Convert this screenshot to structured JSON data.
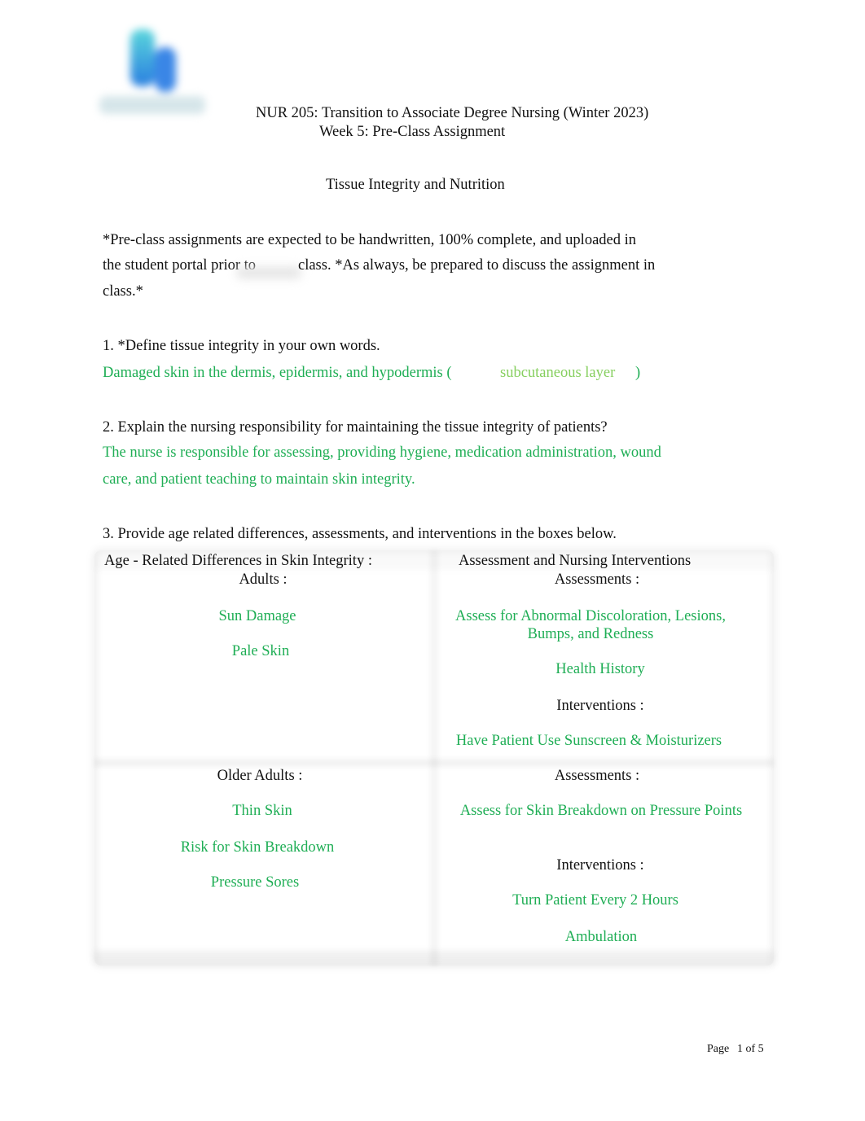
{
  "header": {
    "course_title": "NUR 205: Transition to Associate Degree Nursing (Winter 2023)",
    "week_title": "Week 5: Pre-Class Assignment",
    "topic_title": "Tissue Integrity and Nutrition"
  },
  "instructions": {
    "line1": "*Pre-class assignments are expected to be handwritten, 100% complete, and uploaded in",
    "line2_a": "the student portal prior to",
    "line2_b": "class. *As always, be prepared to discuss the assignment in",
    "line3": "class.*"
  },
  "questions": [
    {
      "prompt": "1. *Define tissue integrity in your own words.",
      "answer_main": "Damaged skin in the dermis, epidermis, and hypodermis (",
      "answer_aside": "subcutaneous layer",
      "answer_close": ")"
    },
    {
      "prompt": "2. Explain the nursing responsibility for maintaining the tissue integrity of patients?",
      "answer_line1": "The nurse is responsible for assessing, providing hygiene, medication administration, wound",
      "answer_line2": "care, and patient teaching to maintain skin integrity."
    },
    {
      "prompt": "3.  Provide age related differences, assessments, and interventions in the boxes below."
    }
  ],
  "table": {
    "col1_header": "Age - Related Differences in Skin Integrity :",
    "col2_header": "Assessment and Nursing Interventions",
    "rows": [
      {
        "group_label": "Adults :",
        "differences": [
          "Sun Damage",
          "Pale Skin"
        ],
        "assessments_label": "Assessments :",
        "assessments": [
          "Assess for Abnormal Discoloration, Lesions, Bumps, and Redness",
          "Health History"
        ],
        "interventions_label": "Interventions :",
        "interventions": [
          "Have Patient Use Sunscreen & Moisturizers"
        ]
      },
      {
        "group_label": "Older Adults :",
        "differences": [
          "Thin Skin",
          "Risk for Skin Breakdown",
          "Pressure Sores"
        ],
        "assessments_label": "Assessments :",
        "assessments": [
          "Assess for Skin Breakdown on Pressure Points"
        ],
        "interventions_label": "Interventions :",
        "interventions": [
          "Turn Patient Every 2 Hours",
          "Ambulation"
        ]
      }
    ]
  },
  "footer": {
    "page_label": "Page",
    "page_number": "1 of 5"
  },
  "colors": {
    "answer_green": "#1fae55",
    "aside_green": "#86cf5f"
  }
}
